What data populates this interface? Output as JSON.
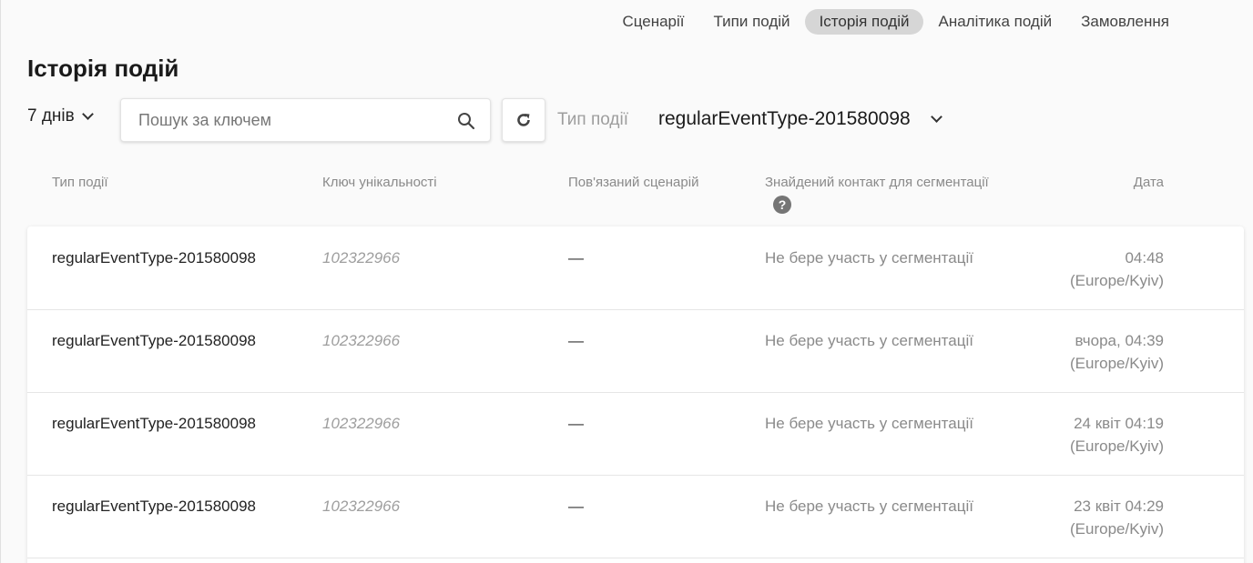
{
  "nav": {
    "items": [
      {
        "label": "Сценарії",
        "active": false
      },
      {
        "label": "Типи подій",
        "active": false
      },
      {
        "label": "Історія подій",
        "active": true
      },
      {
        "label": "Аналітика подій",
        "active": false
      },
      {
        "label": "Замовлення",
        "active": false
      }
    ]
  },
  "page": {
    "title": "Історія подій"
  },
  "toolbar": {
    "period": "7 днів",
    "search_placeholder": "Пошук за ключем",
    "search_value": "",
    "event_type_label": "Тип події",
    "event_type_value": "regularEventType-201580098"
  },
  "table": {
    "headers": {
      "type": "Тип події",
      "key": "Ключ унікальності",
      "scenario": "Пов'язаний сценарій",
      "segment": "Знайдений контакт для сегментації",
      "date": "Дата"
    },
    "rows": [
      {
        "type": "regularEventType-201580098",
        "key": "102322966",
        "scenario": "—",
        "segment": "Не бере участь у сегментації",
        "date": "04:48",
        "tz": "(Europe/Kyiv)"
      },
      {
        "type": "regularEventType-201580098",
        "key": "102322966",
        "scenario": "—",
        "segment": "Не бере участь у сегментації",
        "date": "вчора, 04:39",
        "tz": "(Europe/Kyiv)"
      },
      {
        "type": "regularEventType-201580098",
        "key": "102322966",
        "scenario": "—",
        "segment": "Не бере участь у сегментації",
        "date": "24 квіт 04:19",
        "tz": "(Europe/Kyiv)"
      },
      {
        "type": "regularEventType-201580098",
        "key": "102322966",
        "scenario": "—",
        "segment": "Не бере участь у сегментації",
        "date": "23 квіт 04:29",
        "tz": "(Europe/Kyiv)"
      }
    ]
  },
  "colors": {
    "nav_active_bg": "#d6d6d6",
    "muted_text": "#8a8a8a"
  },
  "icons": {
    "search": "search-icon",
    "refresh": "refresh-icon",
    "help": "help-icon",
    "dropdown": "chevron-down-icon"
  }
}
